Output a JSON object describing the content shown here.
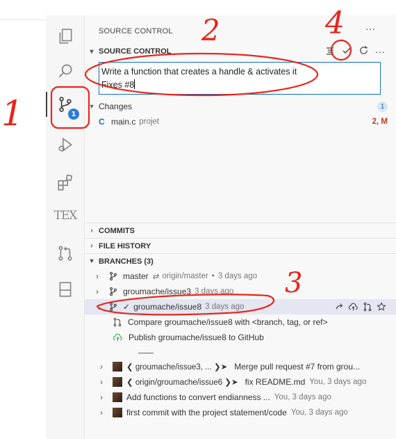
{
  "view_title": "SOURCE CONTROL",
  "view_more": "···",
  "sections": {
    "source_control": "SOURCE CONTROL",
    "commits": "COMMITS",
    "file_history": "FILE HISTORY",
    "branches": "BRANCHES (3)"
  },
  "activity_badge": "1",
  "tex_label": "TEX",
  "commit_message": {
    "line1": "Write a function that creates a handle & activates it",
    "line2": "Fixes #8"
  },
  "changes": {
    "label": "Changes",
    "count": "1",
    "file_icon": "C",
    "file_name": "main.c",
    "file_folder": "projet",
    "file_status": "2, M"
  },
  "branches": [
    {
      "name": "master",
      "upstream_arrow": "⇄",
      "upstream": "origin/master",
      "dot": "•",
      "time": "3 days ago"
    },
    {
      "name": "groumache/issue3",
      "time": "3 days ago"
    },
    {
      "check": "✓",
      "name": "groumache/issue8",
      "time": "3 days ago"
    }
  ],
  "branch_actions": {
    "compare": "Compare groumache/issue8 with <branch, tag, or ref>",
    "publish": "Publish groumache/issue8 to GitHub"
  },
  "commits": [
    {
      "refs": "❮ groumache/issue3, ... ❯➤",
      "message": "Merge pull request #7 from grou...",
      "meta": ""
    },
    {
      "refs": "❮ origin/groumache/issue6 ❯➤",
      "message": "fix README.md",
      "meta": "You, 3 days ago"
    },
    {
      "refs": "",
      "message": "Add functions to convert endianness ...",
      "meta": "You, 3 days ago"
    },
    {
      "refs": "",
      "message": "first commit with the project statement/code",
      "meta": "You, 3 days ago"
    }
  ],
  "annotations": [
    "1",
    "2",
    "3",
    "4"
  ],
  "colors": {
    "annotation_red": "#e8261c",
    "accent_blue": "#0e70c0",
    "badge_blue": "#2f7ad6",
    "modified_red": "#c0392b"
  }
}
